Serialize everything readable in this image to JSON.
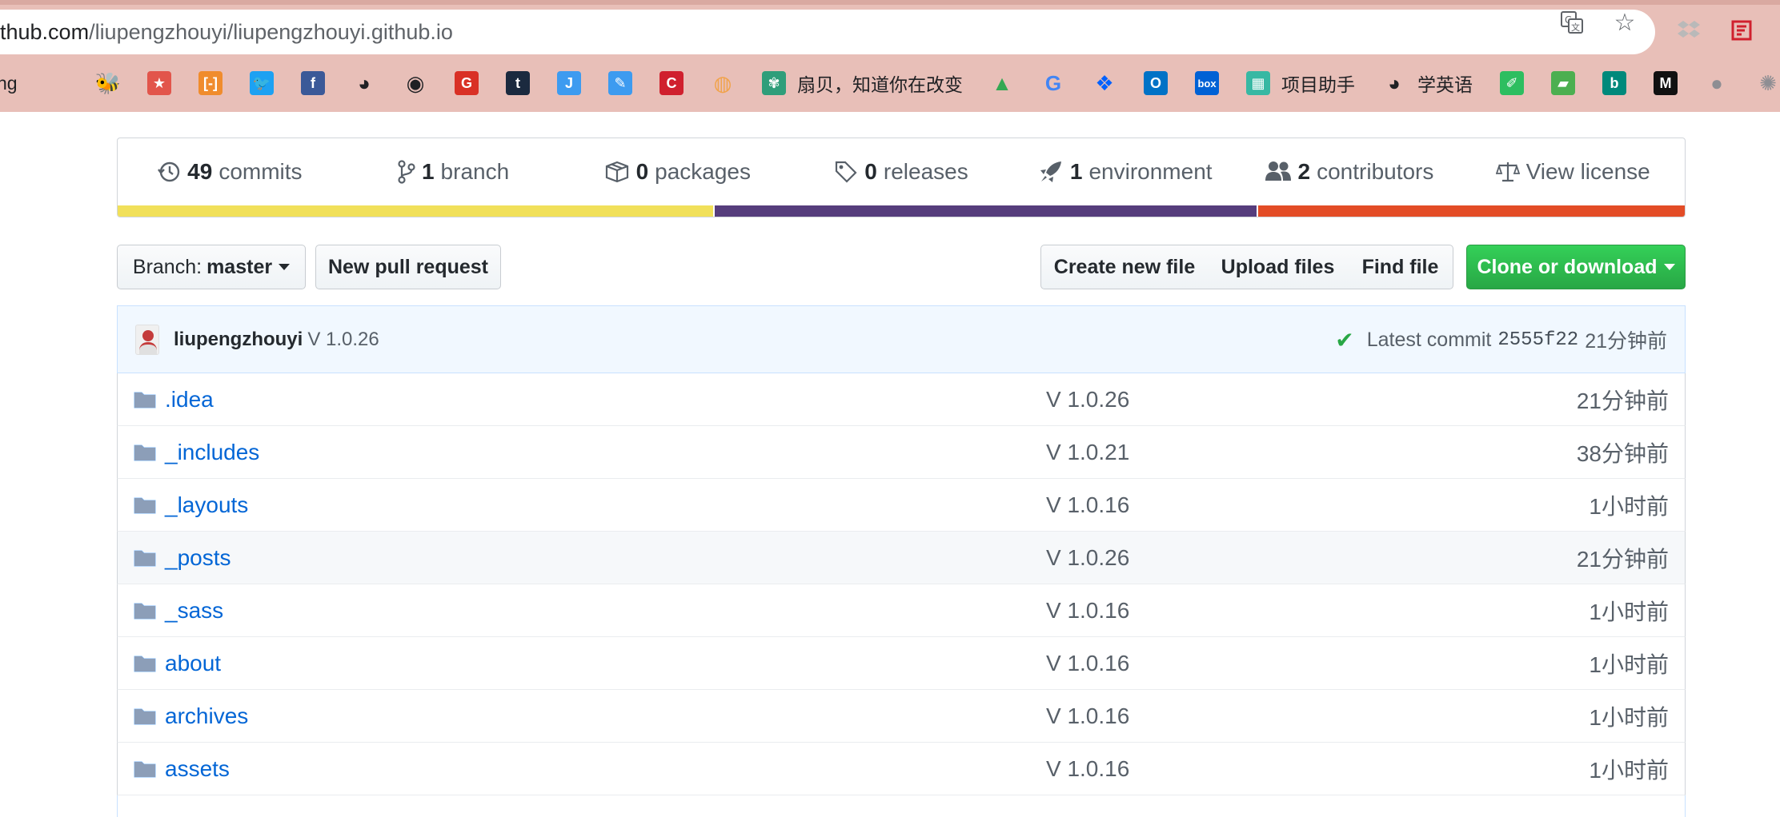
{
  "browser": {
    "url_host": "thub.com",
    "url_path": "/liupengzhouyi/liupengzhouyi.github.io",
    "bookmarks": [
      {
        "icon": "partial-text-bookmark",
        "label": "ng",
        "color": "#202124"
      },
      {
        "icon": "bee-icon",
        "label": "",
        "color": "#202124"
      },
      {
        "icon": "star-box-icon",
        "label": "",
        "color": "#e2554b"
      },
      {
        "icon": "bracket-icon",
        "label": "",
        "color": "#f08c2d"
      },
      {
        "icon": "twitter-icon",
        "label": "",
        "color": "#1da1f2"
      },
      {
        "icon": "facebook-icon",
        "label": "",
        "color": "#3b5998"
      },
      {
        "icon": "globe-icon",
        "label": "",
        "color": "#202124"
      },
      {
        "icon": "github-icon",
        "label": "",
        "color": "#202124"
      },
      {
        "icon": "g-red-icon",
        "label": "",
        "color": "#d93025"
      },
      {
        "icon": "tumblr-icon",
        "label": "",
        "color": "#1b2a3f"
      },
      {
        "icon": "j-icon",
        "label": "",
        "color": "#3d9bf0"
      },
      {
        "icon": "pen-icon",
        "label": "",
        "color": "#3d9bf0"
      },
      {
        "icon": "c-red-icon",
        "label": "",
        "color": "#d0202e"
      },
      {
        "icon": "color-wheel-icon",
        "label": "",
        "color": "#f1a34b"
      },
      {
        "icon": "shanbay-icon",
        "label": "扇贝，知道你在改变",
        "color": "#2f9e7a"
      },
      {
        "icon": "drive-icon",
        "label": "",
        "color": "#34a853"
      },
      {
        "icon": "google-icon",
        "label": "",
        "color": "#4285f4"
      },
      {
        "icon": "dropbox-icon",
        "label": "",
        "color": "#0061ff"
      },
      {
        "icon": "outlook-icon",
        "label": "",
        "color": "#0072c6"
      },
      {
        "icon": "box-icon",
        "label": "",
        "color": "#0061d5"
      },
      {
        "icon": "grid-icon",
        "label": "项目助手",
        "color": "#37b8a3"
      },
      {
        "icon": "globe-icon",
        "label": "学英语",
        "color": "#202124"
      },
      {
        "icon": "evernote-icon",
        "label": "",
        "color": "#2dbe60"
      },
      {
        "icon": "book-icon",
        "label": "",
        "color": "#4caf50"
      },
      {
        "icon": "bing-icon",
        "label": "",
        "color": "#00897b"
      },
      {
        "icon": "m-icon",
        "label": "",
        "color": "#111111"
      },
      {
        "icon": "apple-icon",
        "label": "",
        "color": "#8e8e93"
      },
      {
        "icon": "wheel-icon",
        "label": "",
        "color": "#8e8e93"
      }
    ]
  },
  "summary": {
    "commits_num": "49",
    "commits_label": "commits",
    "branch_num": "1",
    "branch_label": "branch",
    "packages_num": "0",
    "packages_label": "packages",
    "releases_num": "0",
    "releases_label": "releases",
    "environment_num": "1",
    "environment_label": "environment",
    "contributors_num": "2",
    "contributors_label": "contributors",
    "license_label": "View license",
    "languages": [
      {
        "share": 38,
        "color": "#f1e05a"
      },
      {
        "share": 34.7,
        "color": "#563d7c"
      },
      {
        "share": 27.3,
        "color": "#e34c26"
      }
    ]
  },
  "toolbar": {
    "branch_prefix": "Branch:",
    "branch_name": "master",
    "new_pr": "New pull request",
    "create_file": "Create new file",
    "upload_files": "Upload files",
    "find_file": "Find file",
    "clone": "Clone or download"
  },
  "commit": {
    "author": "liupengzhouyi",
    "message": "V 1.0.26",
    "latest_label": "Latest commit",
    "sha": "2555f22",
    "age": "21分钟前"
  },
  "files": [
    {
      "name": ".idea",
      "message": "V 1.0.26",
      "age": "21分钟前"
    },
    {
      "name": "_includes",
      "message": "V 1.0.21",
      "age": "38分钟前"
    },
    {
      "name": "_layouts",
      "message": "V 1.0.16",
      "age": "1小时前"
    },
    {
      "name": "_posts",
      "message": "V 1.0.26",
      "age": "21分钟前"
    },
    {
      "name": "_sass",
      "message": "V 1.0.16",
      "age": "1小时前"
    },
    {
      "name": "about",
      "message": "V 1.0.16",
      "age": "1小时前"
    },
    {
      "name": "archives",
      "message": "V 1.0.16",
      "age": "1小时前"
    },
    {
      "name": "assets",
      "message": "V 1.0.16",
      "age": "1小时前"
    }
  ]
}
